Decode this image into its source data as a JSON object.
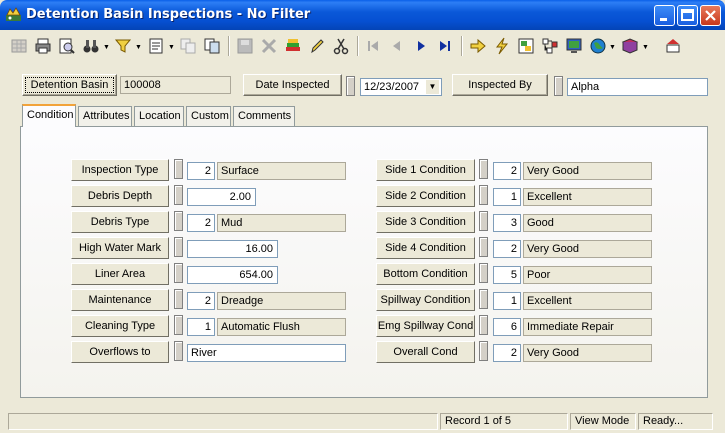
{
  "window": {
    "title": "Detention Basin Inspections - No Filter"
  },
  "header": {
    "basin_label": "Detention Basin",
    "basin_value": "100008",
    "date_label": "Date Inspected",
    "date_value": "12/23/2007",
    "inspector_label": "Inspected By",
    "inspector_value": "Alpha"
  },
  "tabs": [
    "Condition",
    "Attributes",
    "Location",
    "Custom",
    "Comments"
  ],
  "left_fields": [
    {
      "label": "Inspection Type",
      "code": "2",
      "desc": "Surface"
    },
    {
      "label": "Debris Depth",
      "value": "2.00"
    },
    {
      "label": "Debris Type",
      "code": "2",
      "desc": "Mud"
    },
    {
      "label": "High Water Mark",
      "value": "16.00"
    },
    {
      "label": "Liner Area",
      "value": "654.00"
    },
    {
      "label": "Maintenance",
      "code": "2",
      "desc": "Dreadge"
    },
    {
      "label": "Cleaning Type",
      "code": "1",
      "desc": "Automatic Flush"
    },
    {
      "label": "Overflows to",
      "text": "River"
    }
  ],
  "right_fields": [
    {
      "label": "Side 1 Condition",
      "code": "2",
      "desc": "Very Good"
    },
    {
      "label": "Side 2 Condition",
      "code": "1",
      "desc": "Excellent"
    },
    {
      "label": "Side 3 Condition",
      "code": "3",
      "desc": "Good"
    },
    {
      "label": "Side 4 Condition",
      "code": "2",
      "desc": "Very Good"
    },
    {
      "label": "Bottom Condition",
      "code": "5",
      "desc": "Poor"
    },
    {
      "label": "Spillway Condition",
      "code": "1",
      "desc": "Excellent"
    },
    {
      "label": "Emg Spillway Cond",
      "code": "6",
      "desc": "Immediate Repair"
    },
    {
      "label": "Overall Cond",
      "code": "2",
      "desc": "Very Good"
    }
  ],
  "status": {
    "record": "Record 1 of 5",
    "mode": "View Mode",
    "state": "Ready..."
  },
  "colors": {
    "titlebar": "#0a58d8",
    "tab_highlight": "#f2a33a",
    "window_bg": "#ece9d8"
  }
}
